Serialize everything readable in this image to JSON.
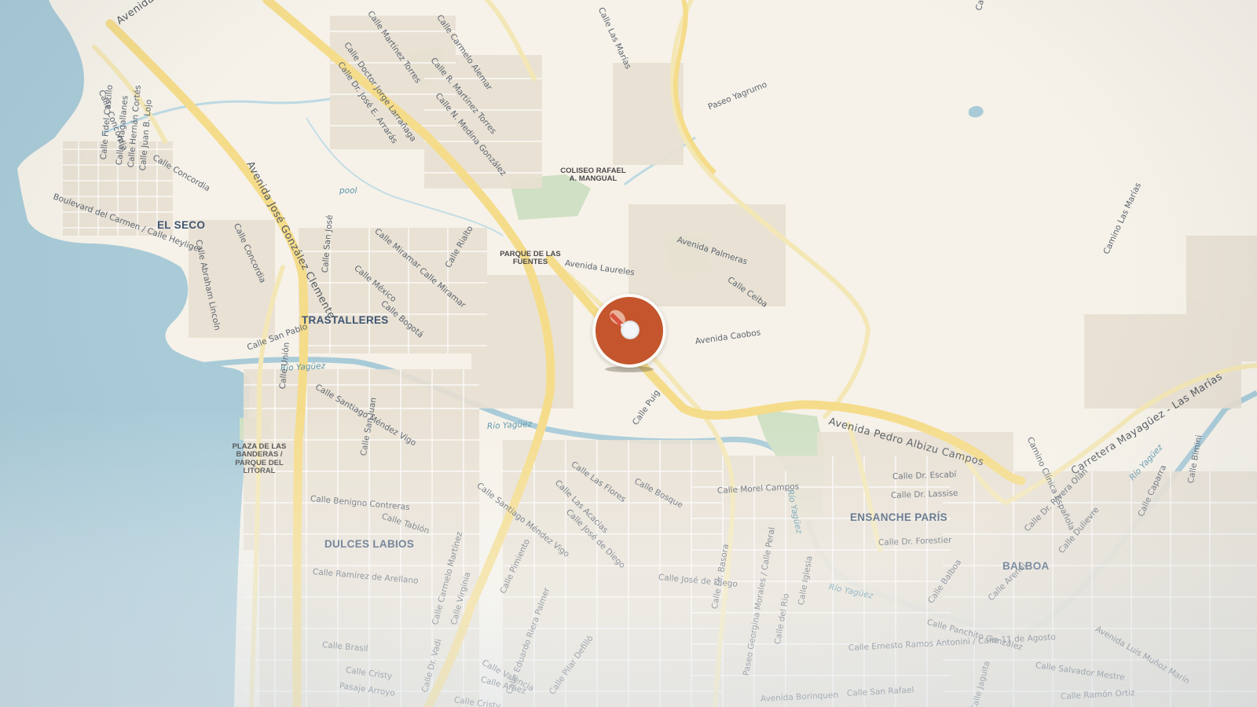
{
  "map": {
    "colors": {
      "land": "#f6f2e9",
      "water": "#a9cbd8",
      "major_road": "#f5dc8a",
      "secondary_road": "#f4e7b6",
      "street": "#ffffff",
      "building": "#e6ded0",
      "park": "#cfe0c4",
      "marker": "#c4552c"
    },
    "neighborhoods": [
      "EL SECO",
      "TRASTALLERES",
      "DULCES LABIOS",
      "ENSANCHE PARÍS",
      "BALBOA"
    ],
    "pois": [
      {
        "line1": "COLISEO RAFAEL",
        "line2": "A. MANGUAL"
      },
      {
        "line1": "PARQUE DE LAS",
        "line2": "FUENTES"
      },
      {
        "line1": "PLAZA DE LAS",
        "line2": "BANDERAS /",
        "line3": "PARQUE DEL",
        "line4": "LITORAL"
      }
    ],
    "water_labels": [
      "Río Yagüez",
      "Río Yagüez",
      "Río Yagüez",
      "Río Yagüez",
      "Río Yagüez",
      "pool"
    ],
    "major_roads": [
      "Avenida Pedro Albizu Campos",
      "Avenida José González Clemente",
      "Carretera Mayagüez - Las Marías",
      "Avenida"
    ],
    "streets": [
      "Calle Concordia",
      "Calle Concordia",
      "Calle Concordia",
      "Calle Fidel Castillo",
      "Calle Magallanes",
      "Calle Hernán Cortés",
      "Calle Juan B. Lojo",
      "Boulevard del Carmen / Calle Heyliger",
      "Calle Abraham Lincoln",
      "Calle San José",
      "Calle San Pablo",
      "Calle Unión",
      "Calle Santiago Méndez Vigo",
      "Calle Santiago Méndez Vigo",
      "Calle San Juan",
      "Calle Benigno Contreras",
      "Calle Tablón",
      "Calle Ramírez de Arellano",
      "Calle Carmelo Martínez",
      "Calle Virginia",
      "Calle Pimiento",
      "Calle Brasil",
      "Calle Cristy",
      "Pasaje Arroyo",
      "Calle Dr. Vadi",
      "Calle Valencia",
      "Calle Aráez",
      "Calle Cristy",
      "Calle Eduardo Riera Palmer",
      "Calle Pilar Defilló",
      "Calle Dr. José E. Arrarás",
      "Calle Doctor Jorge Larrañaga",
      "Calle Martínez Torres",
      "Calle Carmelo Alemar",
      "Calle R. Martínez Torres",
      "Calle N. Medina González",
      "Calle Las Marías",
      "Paseo Yagrumo",
      "Calle Miramar",
      "Calle Miramar",
      "Calle Rialto",
      "Calle México",
      "Calle Bogotá",
      "Avenida Laureles",
      "Avenida Palmeras",
      "Calle Ceiba",
      "Avenida Caobos",
      "Calle Puig",
      "Calle Las Flores",
      "Calle Las Acacias",
      "Calle José de Diego",
      "Calle Bosque",
      "Calle Morel Campos",
      "Calle José de Diego",
      "Calle Dr. Basora",
      "Paseo Georgina Morales / Calle Peral",
      "Calle del Río",
      "Calle Iglesia",
      "Calle Dr. Escabí",
      "Calle Dr. Lassise",
      "Calle Dr. Forestier",
      "Calle Balboa",
      "Calle Panchito González",
      "Calle Ernesto Ramos Antonini / Calle 11 de Agosto",
      "Calle Salvador Mestre",
      "Calle Jaguita",
      "Calle San Rafael",
      "Avenida Borinquen",
      "Calle Ramón Ortiz",
      "Avenida Luis Muñoz Marín",
      "Calle Dr. Rivera Olán",
      "Calle Dulievre",
      "Calle Caparra",
      "Calle Bimini",
      "Calle Arenal",
      "Camino Clínica Española",
      "Camino Las Marías",
      "Calle San"
    ]
  }
}
